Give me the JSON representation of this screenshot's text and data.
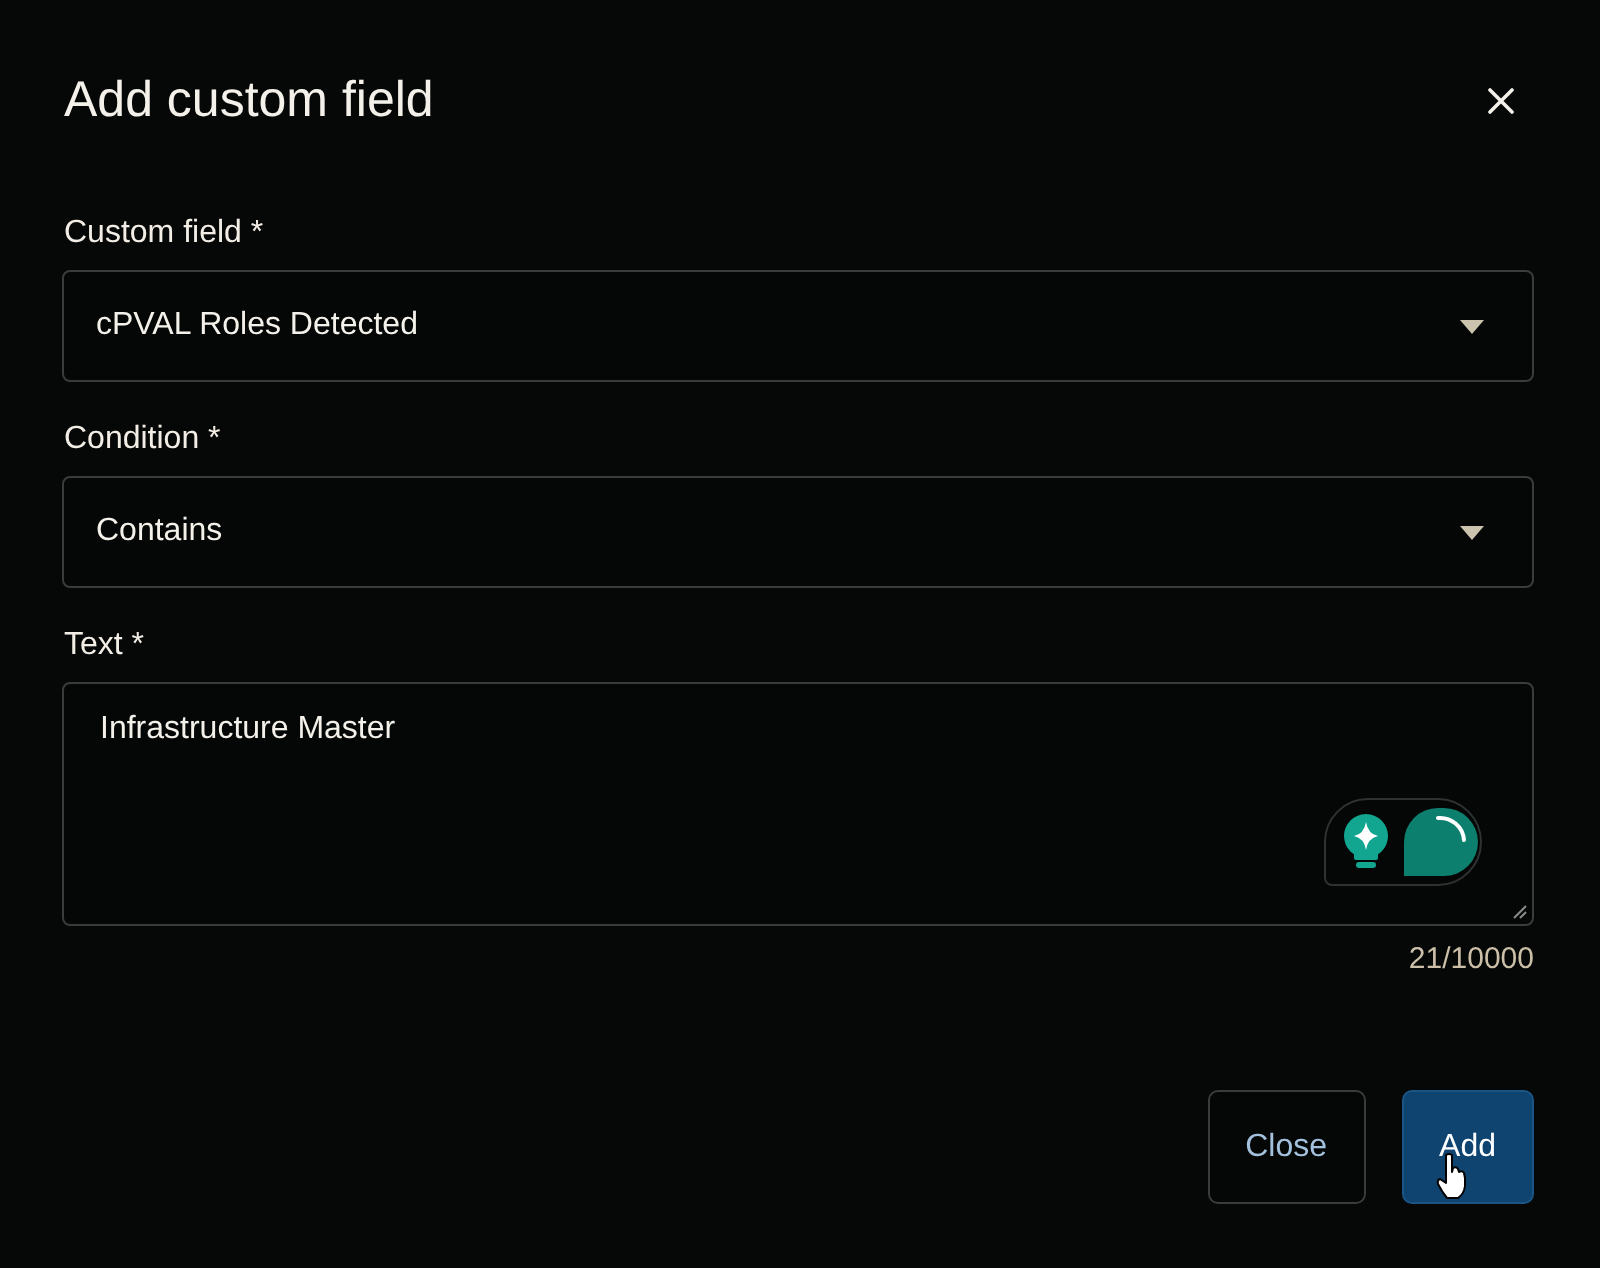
{
  "dialog": {
    "title": "Add custom field"
  },
  "fields": [
    {
      "kind": "select",
      "label": "Custom field *",
      "value": "cPVAL Roles Detected"
    },
    {
      "kind": "select",
      "label": "Condition *",
      "value": "Contains"
    },
    {
      "kind": "textarea",
      "label": "Text *",
      "value": "Infrastructure Master",
      "counter": "21/10000"
    }
  ],
  "buttons": [
    {
      "kind": "secondary",
      "label": "Close"
    },
    {
      "kind": "primary",
      "label": "Add"
    }
  ]
}
